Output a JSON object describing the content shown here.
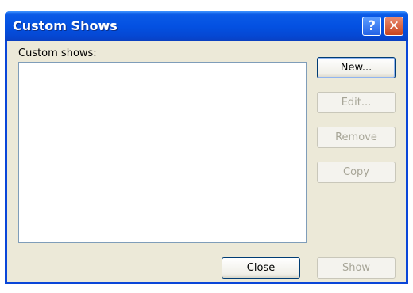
{
  "window": {
    "title": "Custom Shows"
  },
  "titlebar": {
    "help_label": "?",
    "close_label": "✕"
  },
  "list": {
    "label": "Custom shows:",
    "items": []
  },
  "buttons": {
    "new": "New...",
    "edit": "Edit...",
    "remove": "Remove",
    "copy": "Copy",
    "close": "Close",
    "show": "Show"
  },
  "colors": {
    "titlebar": "#0451e2",
    "dialog_bg": "#ece9d8",
    "close_button": "#c8451f"
  },
  "icons": {
    "help": "question-mark",
    "close": "x-mark"
  }
}
